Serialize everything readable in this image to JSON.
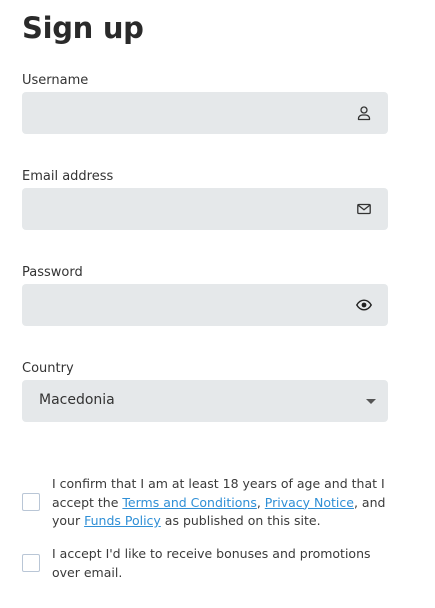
{
  "title": "Sign up",
  "fields": {
    "username": {
      "label": "Username",
      "value": "",
      "icon": "user-icon"
    },
    "email": {
      "label": "Email address",
      "value": "",
      "icon": "envelope-icon"
    },
    "password": {
      "label": "Password",
      "value": "",
      "icon": "eye-icon"
    },
    "country": {
      "label": "Country",
      "selected": "Macedonia",
      "icon": "caret-down-icon"
    }
  },
  "consents": {
    "age": {
      "checked": false,
      "part1": "I confirm that I am at least 18 years of age and that I accept the ",
      "terms_link": "Terms and Conditions",
      "sep1": ", ",
      "privacy_link": "Privacy Notice",
      "part2": ", and your ",
      "funds_link": "Funds Policy",
      "part3": " as published on this site."
    },
    "promotions": {
      "checked": false,
      "text": "I accept I'd like to receive bonuses and promotions over email."
    }
  },
  "colors": {
    "field_bg": "#e5e8ea",
    "link": "#2f8fd6",
    "checkbox_border": "#b9c6d6"
  }
}
